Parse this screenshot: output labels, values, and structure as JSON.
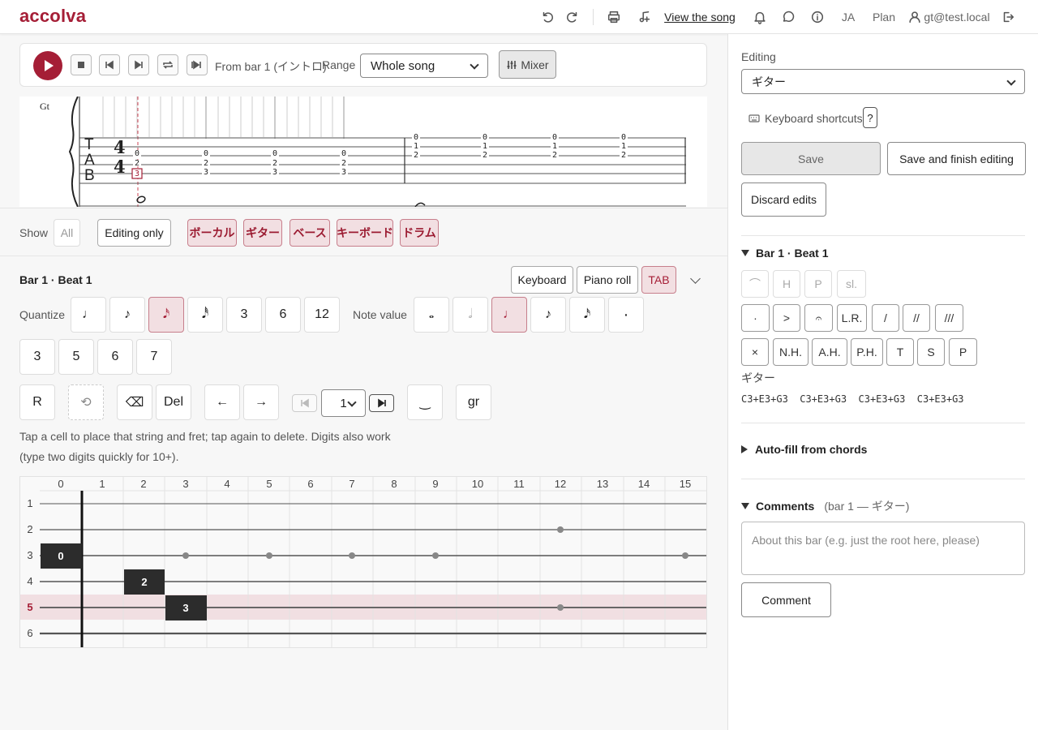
{
  "header": {
    "logo": "accolva",
    "view_song": "View the song",
    "lang": "JA",
    "plan": "Plan",
    "user": "gt@test.local"
  },
  "player": {
    "from_bar": "From bar 1 (イントロ)",
    "range_label": "Range",
    "range_value": "Whole song",
    "mixer": "Mixer"
  },
  "score": {
    "track": "Gt",
    "tab": [
      "T",
      "A",
      "B"
    ],
    "timesig": [
      "4",
      "4"
    ]
  },
  "show": {
    "label": "Show",
    "all": "All",
    "editing_only": "Editing only",
    "tracks": [
      "ボーカル",
      "ギター",
      "ベース",
      "キーボード",
      "ドラム"
    ]
  },
  "editor": {
    "title": "Bar 1 · Beat 1",
    "views": [
      "Keyboard",
      "Piano roll",
      "TAB"
    ],
    "quantize_label": "Quantize",
    "quantize": [
      "♩",
      "♪",
      "𝅘𝅥𝅯",
      "𝅘𝅥𝅰",
      "3",
      "6",
      "12"
    ],
    "note_value_label": "Note value",
    "note_values": [
      "𝅝",
      "𝅗𝅥",
      "♩",
      "♪",
      "𝅘𝅥𝅯",
      "·"
    ],
    "tuplets": [
      "3",
      "5",
      "6",
      "7"
    ],
    "tools": {
      "rest": "R",
      "undo": "⟲",
      "backspace": "⌫",
      "del": "Del",
      "left": "←",
      "right": "→",
      "bar": "1",
      "tie": "‿",
      "grace": "gr"
    },
    "hint1": "Tap a cell to place that string and fret; tap again to delete. Digits also work",
    "hint2": "(type two digits quickly for 10+)."
  },
  "fretboard": {
    "frets": [
      "0",
      "1",
      "2",
      "3",
      "4",
      "5",
      "6",
      "7",
      "8",
      "9",
      "10",
      "11",
      "12",
      "13",
      "14",
      "15"
    ],
    "strings": [
      "1",
      "2",
      "3",
      "4",
      "5",
      "6"
    ],
    "notes": [
      {
        "string": 3,
        "fret": 0,
        "label": "0"
      },
      {
        "string": 4,
        "fret": 2,
        "label": "2"
      },
      {
        "string": 5,
        "fret": 3,
        "label": "3"
      }
    ],
    "active_string": 5
  },
  "sidebar": {
    "editing_label": "Editing",
    "editing_value": "ギター",
    "shortcuts": "Keyboard shortcuts",
    "shortcut_key": "?",
    "save": "Save",
    "save_finish": "Save and finish editing",
    "discard": "Discard edits",
    "bar_section": "Bar 1 · Beat 1",
    "art_row1": [
      "⌒",
      "H",
      "P",
      "sl."
    ],
    "art_row2": [
      "·",
      ">",
      "𝄐",
      "L.R.",
      "/",
      "//",
      "///"
    ],
    "art_row3": [
      "×",
      "N.H.",
      "A.H.",
      "P.H.",
      "T",
      "S",
      "P"
    ],
    "track_name": "ギター",
    "chords": "C3+E3+G3  C3+E3+G3  C3+E3+G3  C3+E3+G3",
    "autofill": "Auto-fill from chords",
    "comments": "Comments",
    "comments_ctx": "(bar 1 — ギター)",
    "comment_placeholder": "About this bar (e.g. just the root here, please)",
    "comment_btn": "Comment"
  },
  "colors": {
    "accent": "#a51e36",
    "accent_bg": "#f2dfe2"
  }
}
